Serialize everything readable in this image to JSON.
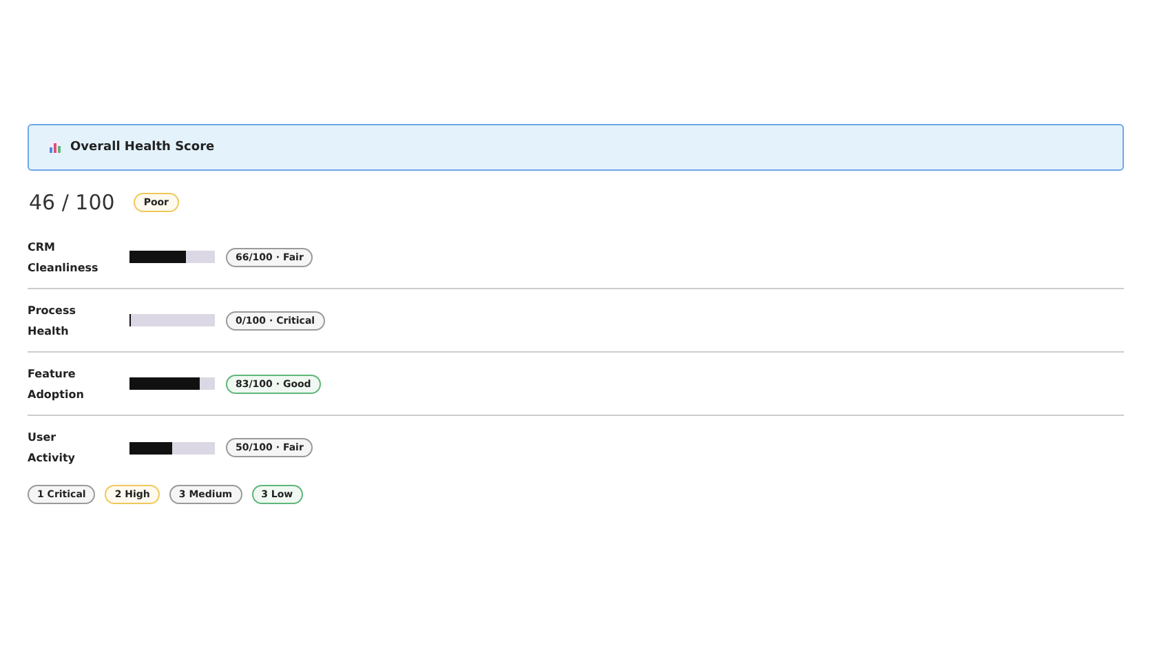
{
  "header": {
    "title": "Overall Health Score"
  },
  "score": {
    "value": "46 / 100",
    "badge": {
      "label": "Poor",
      "color": "#f0c85a"
    }
  },
  "metrics": [
    {
      "name": "CRM Cleanliness",
      "level": 0.66,
      "badge": {
        "label": "66/100 · Fair",
        "color": "#9a9a9a"
      }
    },
    {
      "name": "Process Health",
      "level": 0,
      "badge": {
        "label": "0/100 · Critical",
        "color": "#9a9a9a"
      }
    },
    {
      "name": "Feature Adoption",
      "level": 0.83,
      "badge": {
        "label": "83/100 · Good",
        "color": "#5db77a"
      }
    },
    {
      "name": "User Activity",
      "level": 0.5,
      "badge": {
        "label": "50/100 · Fair",
        "color": "#9a9a9a"
      }
    }
  ],
  "issues": [
    {
      "label": "1 Critical",
      "color": "#9a9a9a"
    },
    {
      "label": "2 High",
      "color": "#f0c85a"
    },
    {
      "label": "3 Medium",
      "color": "#9a9a9a"
    },
    {
      "label": "3 Low",
      "color": "#5db77a"
    }
  ]
}
